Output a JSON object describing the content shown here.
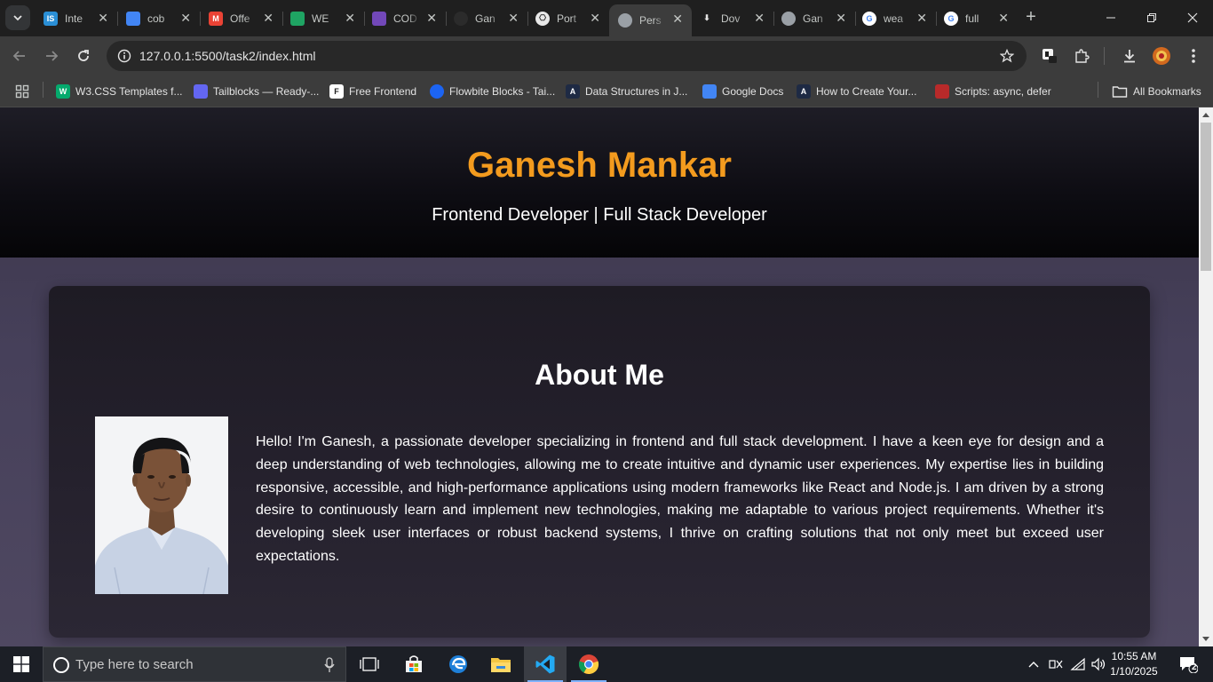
{
  "browser": {
    "tabs": [
      {
        "title": "Inte",
        "icon": "interview-bit-icon",
        "color": "#2a8fd6",
        "glyph": "IS",
        "active": false
      },
      {
        "title": "cob",
        "icon": "google-docs-icon",
        "color": "#4285f4",
        "glyph": "",
        "active": false
      },
      {
        "title": "Offe",
        "icon": "gmail-icon",
        "color": "#ea4335",
        "glyph": "M",
        "active": false
      },
      {
        "title": "WE",
        "icon": "google-drive-icon",
        "color": "#1fa463",
        "glyph": "",
        "active": false
      },
      {
        "title": "COD",
        "icon": "google-forms-icon",
        "color": "#7248b9",
        "glyph": "",
        "active": false
      },
      {
        "title": "Gan",
        "icon": "github-icon",
        "color": "#2b2b2b",
        "glyph": "",
        "active": false
      },
      {
        "title": "Port",
        "icon": "chatgpt-icon",
        "color": "#e8e8e8",
        "glyph": "",
        "active": false
      },
      {
        "title": "Pers",
        "icon": "globe-icon",
        "color": "#9aa0a6",
        "glyph": "",
        "active": true
      },
      {
        "title": "Dov",
        "icon": "download-icon",
        "color": "#c4c7c5",
        "glyph": "",
        "active": false
      },
      {
        "title": "Gan",
        "icon": "globe-icon",
        "color": "#9aa0a6",
        "glyph": "",
        "active": false
      },
      {
        "title": "wea",
        "icon": "google-icon",
        "color": "#ffffff",
        "glyph": "G",
        "active": false
      },
      {
        "title": "full",
        "icon": "google-icon",
        "color": "#ffffff",
        "glyph": "G",
        "active": false
      }
    ],
    "url": "127.0.0.1:5500/task2/index.html",
    "bookmarks": [
      {
        "label": "W3.CSS Templates f...",
        "icon": "w3schools-icon",
        "color": "#04aa6d",
        "glyph": "W"
      },
      {
        "label": "Tailblocks — Ready-...",
        "icon": "tailblocks-icon",
        "color": "#6366f1",
        "glyph": ""
      },
      {
        "label": "Free Frontend",
        "icon": "free-frontend-icon",
        "color": "#ffffff",
        "glyph": "F"
      },
      {
        "label": "Flowbite Blocks - Tai...",
        "icon": "flowbite-icon",
        "color": "#1c64f2",
        "glyph": ""
      },
      {
        "label": "Data Structures in J...",
        "icon": "javascript-info-icon",
        "color": "#1e2a44",
        "glyph": "A"
      },
      {
        "label": "Google Docs",
        "icon": "google-docs-icon",
        "color": "#4285f4",
        "glyph": ""
      },
      {
        "label": "How to Create Your...",
        "icon": "javascript-info-icon",
        "color": "#1e2a44",
        "glyph": "A"
      },
      {
        "label": "Scripts: async, defer",
        "icon": "javascript-info-icon",
        "color": "#b82a2a",
        "glyph": ""
      }
    ],
    "all_bookmarks_label": "All Bookmarks"
  },
  "page": {
    "header": {
      "name": "Ganesh Mankar",
      "tagline": "Frontend Developer | Full Stack Developer"
    },
    "about": {
      "heading": "About Me",
      "text": "Hello! I'm Ganesh, a passionate developer specializing in frontend and full stack development. I have a keen eye for design and a deep understanding of web technologies, allowing me to create intuitive and dynamic user experiences. My expertise lies in building responsive, accessible, and high-performance applications using modern frameworks like React and Node.js. I am driven by a strong desire to continuously learn and implement new technologies, making me adaptable to various project requirements. Whether it's developing sleek user interfaces or robust backend systems, I thrive on crafting solutions that not only meet but exceed user expectations."
    }
  },
  "taskbar": {
    "search_placeholder": "Type here to search",
    "time": "10:55 AM",
    "date": "1/10/2025",
    "notification_count": "2"
  },
  "colors": {
    "name_accent": "#f39b1e",
    "taskbar": "#1c1f26"
  }
}
